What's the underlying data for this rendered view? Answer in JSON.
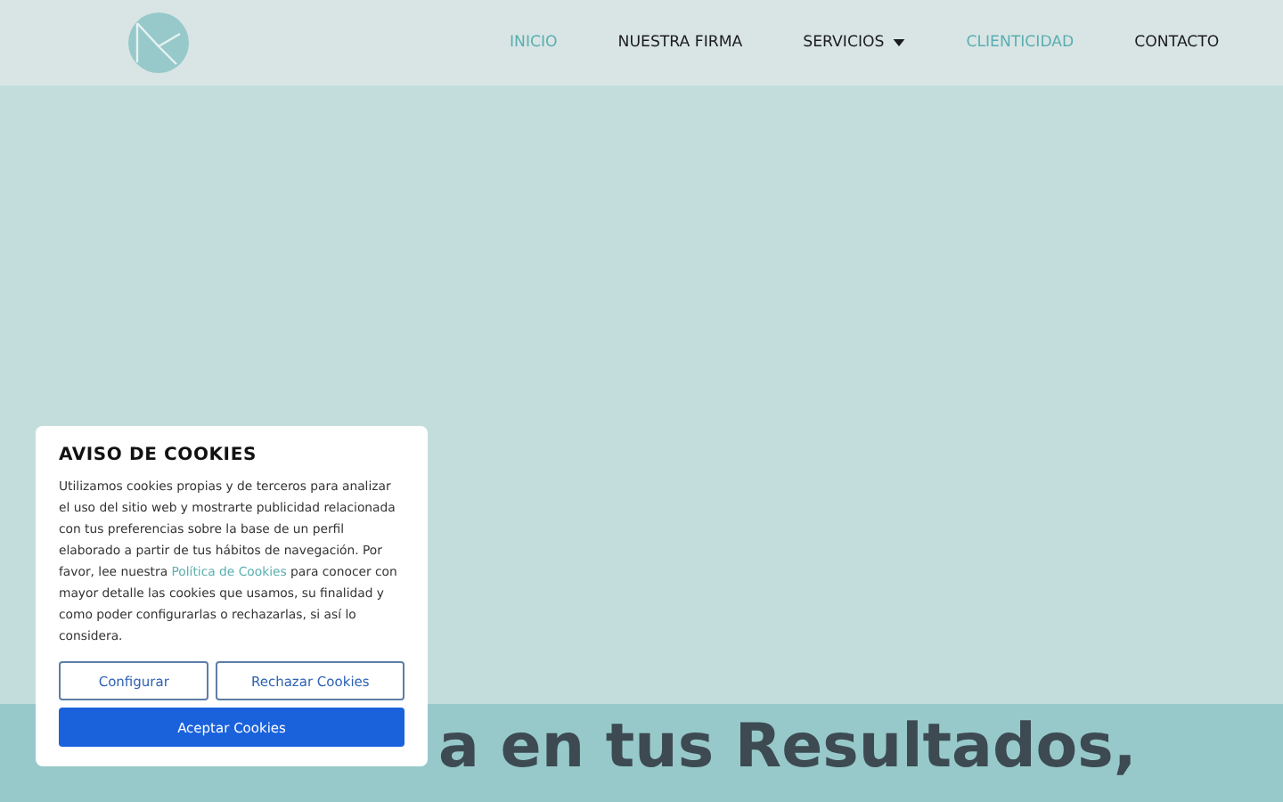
{
  "nav": {
    "items": [
      {
        "label": "INICIO",
        "selected": true,
        "dropdown": false
      },
      {
        "label": "NUESTRA FIRMA",
        "selected": false,
        "dropdown": false
      },
      {
        "label": "SERVICIOS",
        "selected": false,
        "dropdown": true
      },
      {
        "label": "CLIENTICIDAD",
        "selected": true,
        "dropdown": false
      },
      {
        "label": "CONTACTO",
        "selected": false,
        "dropdown": false
      }
    ]
  },
  "hero": {
    "headline_lines": [
      "a en tus Resultados,"
    ]
  },
  "cookie_notice": {
    "title": "AVISO DE COOKIES",
    "text_before_link": "Utilizamos cookies propias y de terceros para analizar el uso del sitio web y mostrarte publicidad relacionada con tus preferencias sobre la base de un perfil elaborado a partir de tus hábitos de navegación. Por favor, lee nuestra",
    "link": "Política de Cookies",
    "text_after_link": "para conocer con mayor detalle las cookies que usamos, su finalidad y como poder configurarlas o rechazarlas, si así lo considera.",
    "buttons": [
      {
        "label": "Configurar",
        "kind": "outline"
      },
      {
        "label": "Rechazar Cookies",
        "kind": "outline"
      },
      {
        "label": "Aceptar Cookies",
        "kind": "primary"
      }
    ]
  }
}
